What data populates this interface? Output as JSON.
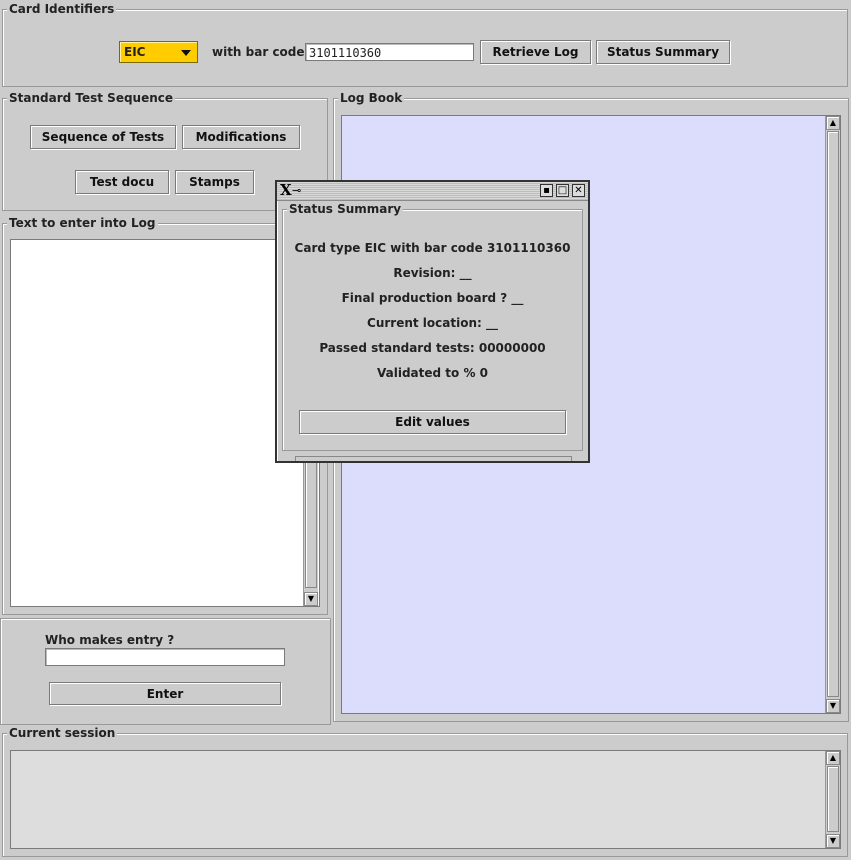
{
  "card_identifiers": {
    "title": "Card Identifiers",
    "card_type": "EIC",
    "bar_code_label": "with bar code",
    "bar_code_value": "3101110360",
    "retrieve_log_label": "Retrieve Log",
    "status_summary_label": "Status Summary"
  },
  "standard_test_sequence": {
    "title": "Standard Test Sequence",
    "sequence_of_tests_label": "Sequence of Tests",
    "modifications_label": "Modifications",
    "test_docu_label": "Test docu",
    "stamps_label": "Stamps"
  },
  "log_text": {
    "title": "Text to enter into Log",
    "value": ""
  },
  "entry": {
    "who_label": "Who makes entry ?",
    "who_value": "",
    "enter_label": "Enter"
  },
  "log_book": {
    "title": "Log Book",
    "background": "#dcdcfc"
  },
  "current_session": {
    "title": "Current session",
    "value": ""
  },
  "status_dialog": {
    "window_icon": "X-pin",
    "group_title": "Status Summary",
    "lines": [
      "Card type EIC with bar code 3101110360",
      "Revision: __",
      "Final production board ? __",
      "Current location: __",
      "Passed standard tests: 00000000",
      "Validated to % 0"
    ],
    "edit_values_label": "Edit values"
  },
  "colors": {
    "window_bg": "#cccccc",
    "combo_accent": "#ffcc00",
    "logbook_bg": "#dcdcfc",
    "session_bg": "#dddddd"
  }
}
